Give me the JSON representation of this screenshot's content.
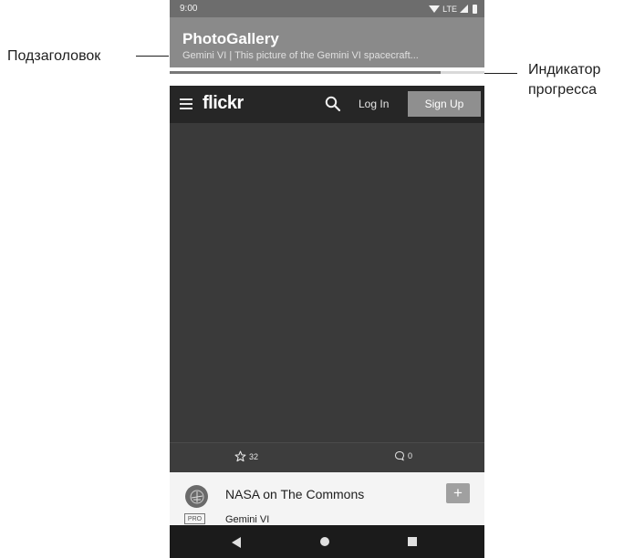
{
  "annotations": {
    "subtitle_label": "Подзаголовок",
    "progress_label_line1": "Индикатор",
    "progress_label_line2": "прогресса"
  },
  "status_bar": {
    "time": "9:00",
    "network": "LTE"
  },
  "app_bar": {
    "title": "PhotoGallery",
    "subtitle": "Gemini VI | This picture of the Gemini VI spacecraft..."
  },
  "progress": {
    "value": 0.86
  },
  "flickr_header": {
    "logo": "flickr",
    "login_label": "Log In",
    "signup_label": "Sign Up"
  },
  "photo": {
    "faves_count": "32",
    "comments_count": "0"
  },
  "info_card": {
    "owner_name": "NASA on The Commons",
    "pro_badge": "PRO",
    "photo_title": "Gemini VI",
    "follow_label": "+"
  },
  "icons": [
    "menu-icon",
    "search-icon",
    "star-icon",
    "comment-icon",
    "wifi-icon",
    "signal-icon",
    "battery-icon",
    "nav-back-icon",
    "nav-home-icon",
    "nav-recents-icon"
  ]
}
